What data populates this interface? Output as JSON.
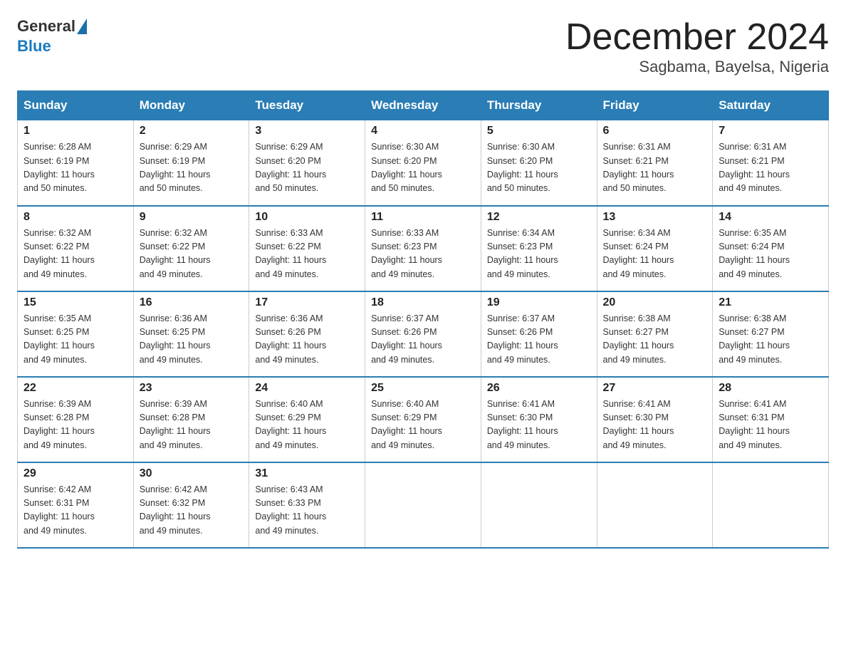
{
  "logo": {
    "general": "General",
    "blue": "Blue"
  },
  "title": "December 2024",
  "subtitle": "Sagbama, Bayelsa, Nigeria",
  "days_of_week": [
    "Sunday",
    "Monday",
    "Tuesday",
    "Wednesday",
    "Thursday",
    "Friday",
    "Saturday"
  ],
  "weeks": [
    [
      {
        "day": "1",
        "sunrise": "6:28 AM",
        "sunset": "6:19 PM",
        "daylight": "11 hours and 50 minutes."
      },
      {
        "day": "2",
        "sunrise": "6:29 AM",
        "sunset": "6:19 PM",
        "daylight": "11 hours and 50 minutes."
      },
      {
        "day": "3",
        "sunrise": "6:29 AM",
        "sunset": "6:20 PM",
        "daylight": "11 hours and 50 minutes."
      },
      {
        "day": "4",
        "sunrise": "6:30 AM",
        "sunset": "6:20 PM",
        "daylight": "11 hours and 50 minutes."
      },
      {
        "day": "5",
        "sunrise": "6:30 AM",
        "sunset": "6:20 PM",
        "daylight": "11 hours and 50 minutes."
      },
      {
        "day": "6",
        "sunrise": "6:31 AM",
        "sunset": "6:21 PM",
        "daylight": "11 hours and 50 minutes."
      },
      {
        "day": "7",
        "sunrise": "6:31 AM",
        "sunset": "6:21 PM",
        "daylight": "11 hours and 49 minutes."
      }
    ],
    [
      {
        "day": "8",
        "sunrise": "6:32 AM",
        "sunset": "6:22 PM",
        "daylight": "11 hours and 49 minutes."
      },
      {
        "day": "9",
        "sunrise": "6:32 AM",
        "sunset": "6:22 PM",
        "daylight": "11 hours and 49 minutes."
      },
      {
        "day": "10",
        "sunrise": "6:33 AM",
        "sunset": "6:22 PM",
        "daylight": "11 hours and 49 minutes."
      },
      {
        "day": "11",
        "sunrise": "6:33 AM",
        "sunset": "6:23 PM",
        "daylight": "11 hours and 49 minutes."
      },
      {
        "day": "12",
        "sunrise": "6:34 AM",
        "sunset": "6:23 PM",
        "daylight": "11 hours and 49 minutes."
      },
      {
        "day": "13",
        "sunrise": "6:34 AM",
        "sunset": "6:24 PM",
        "daylight": "11 hours and 49 minutes."
      },
      {
        "day": "14",
        "sunrise": "6:35 AM",
        "sunset": "6:24 PM",
        "daylight": "11 hours and 49 minutes."
      }
    ],
    [
      {
        "day": "15",
        "sunrise": "6:35 AM",
        "sunset": "6:25 PM",
        "daylight": "11 hours and 49 minutes."
      },
      {
        "day": "16",
        "sunrise": "6:36 AM",
        "sunset": "6:25 PM",
        "daylight": "11 hours and 49 minutes."
      },
      {
        "day": "17",
        "sunrise": "6:36 AM",
        "sunset": "6:26 PM",
        "daylight": "11 hours and 49 minutes."
      },
      {
        "day": "18",
        "sunrise": "6:37 AM",
        "sunset": "6:26 PM",
        "daylight": "11 hours and 49 minutes."
      },
      {
        "day": "19",
        "sunrise": "6:37 AM",
        "sunset": "6:26 PM",
        "daylight": "11 hours and 49 minutes."
      },
      {
        "day": "20",
        "sunrise": "6:38 AM",
        "sunset": "6:27 PM",
        "daylight": "11 hours and 49 minutes."
      },
      {
        "day": "21",
        "sunrise": "6:38 AM",
        "sunset": "6:27 PM",
        "daylight": "11 hours and 49 minutes."
      }
    ],
    [
      {
        "day": "22",
        "sunrise": "6:39 AM",
        "sunset": "6:28 PM",
        "daylight": "11 hours and 49 minutes."
      },
      {
        "day": "23",
        "sunrise": "6:39 AM",
        "sunset": "6:28 PM",
        "daylight": "11 hours and 49 minutes."
      },
      {
        "day": "24",
        "sunrise": "6:40 AM",
        "sunset": "6:29 PM",
        "daylight": "11 hours and 49 minutes."
      },
      {
        "day": "25",
        "sunrise": "6:40 AM",
        "sunset": "6:29 PM",
        "daylight": "11 hours and 49 minutes."
      },
      {
        "day": "26",
        "sunrise": "6:41 AM",
        "sunset": "6:30 PM",
        "daylight": "11 hours and 49 minutes."
      },
      {
        "day": "27",
        "sunrise": "6:41 AM",
        "sunset": "6:30 PM",
        "daylight": "11 hours and 49 minutes."
      },
      {
        "day": "28",
        "sunrise": "6:41 AM",
        "sunset": "6:31 PM",
        "daylight": "11 hours and 49 minutes."
      }
    ],
    [
      {
        "day": "29",
        "sunrise": "6:42 AM",
        "sunset": "6:31 PM",
        "daylight": "11 hours and 49 minutes."
      },
      {
        "day": "30",
        "sunrise": "6:42 AM",
        "sunset": "6:32 PM",
        "daylight": "11 hours and 49 minutes."
      },
      {
        "day": "31",
        "sunrise": "6:43 AM",
        "sunset": "6:33 PM",
        "daylight": "11 hours and 49 minutes."
      },
      null,
      null,
      null,
      null
    ]
  ],
  "labels": {
    "sunrise": "Sunrise:",
    "sunset": "Sunset:",
    "daylight": "Daylight:"
  }
}
